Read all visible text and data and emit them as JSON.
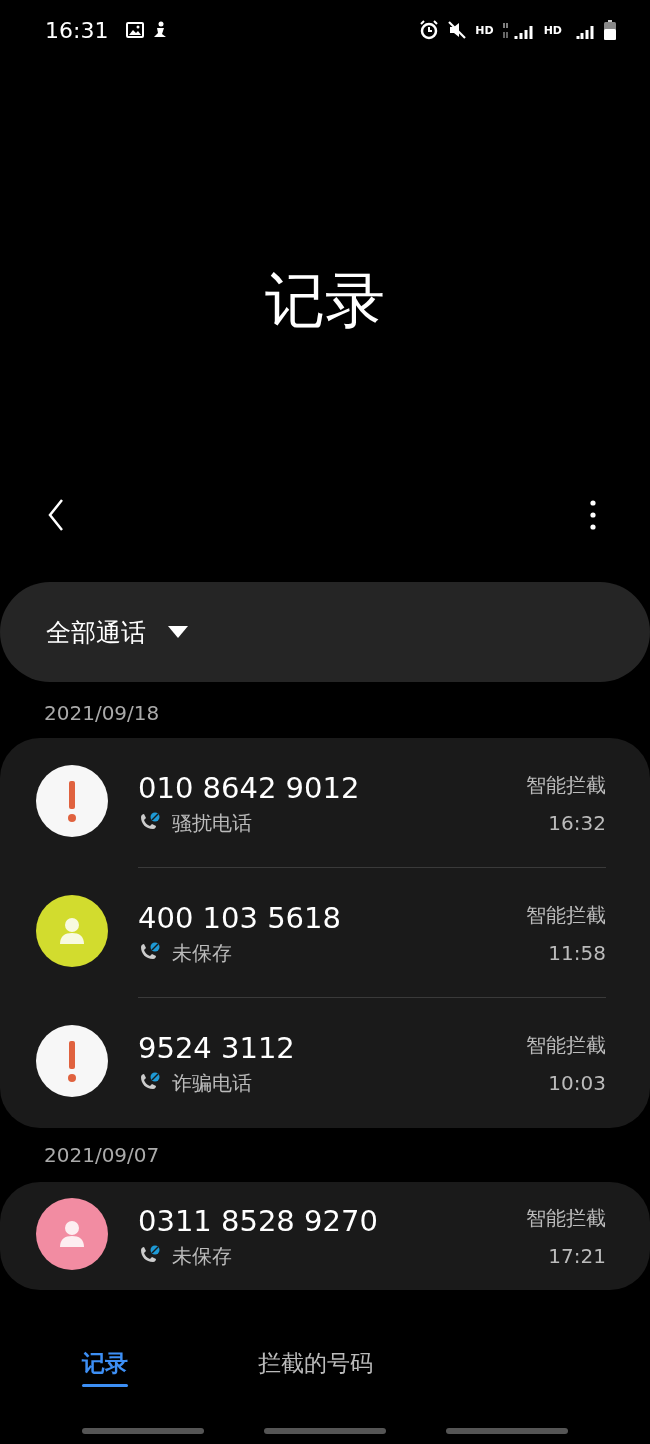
{
  "status_bar": {
    "time": "16:31",
    "network_labels": [
      "HD",
      "HD"
    ]
  },
  "header": {
    "title": "记录"
  },
  "filter": {
    "label": "全部通话"
  },
  "groups": [
    {
      "date": "2021/09/18",
      "calls": [
        {
          "number": "010 8642 9012",
          "label": "骚扰电话",
          "action": "智能拦截",
          "time": "16:32",
          "avatar": {
            "kind": "alert"
          }
        },
        {
          "number": "400 103 5618",
          "label": "未保存",
          "action": "智能拦截",
          "time": "11:58",
          "avatar": {
            "kind": "contact",
            "color": "#d2dc2e"
          }
        },
        {
          "number": "9524 3112",
          "label": "诈骗电话",
          "action": "智能拦截",
          "time": "10:03",
          "avatar": {
            "kind": "alert"
          }
        }
      ]
    },
    {
      "date": "2021/09/07",
      "calls": [
        {
          "number": "0311 8528 9270",
          "label": "未保存",
          "action": "智能拦截",
          "time": "17:21",
          "avatar": {
            "kind": "contact",
            "color": "#f28ca2"
          }
        }
      ]
    }
  ],
  "tabs": [
    {
      "label": "记录",
      "selected": true
    },
    {
      "label": "拦截的号码",
      "selected": false
    }
  ]
}
